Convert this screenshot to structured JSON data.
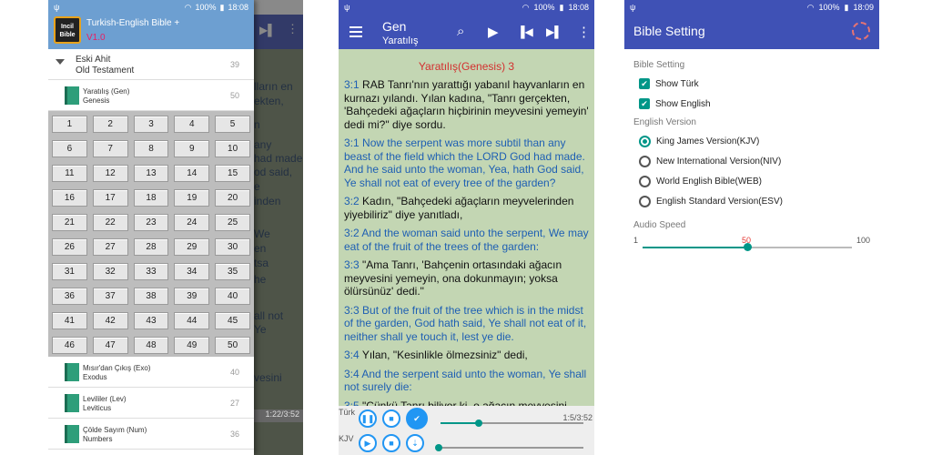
{
  "status": {
    "p1": {
      "battery": "100%",
      "time": "18:08"
    },
    "p2": {
      "battery": "100%",
      "time": "18:08"
    },
    "p3": {
      "battery": "100%",
      "time": "18:09"
    }
  },
  "drawer": {
    "app_title": "Turkish-English Bible +",
    "version": "V1.0",
    "logo_line1": "Incil",
    "logo_line2": "Bible",
    "testament": {
      "title_tr": "Eski Ahit",
      "title_en": "Old Testament",
      "count": "39"
    },
    "books": [
      {
        "tr": "Yaratılış (Gen)",
        "en": "Genesis",
        "count": "50"
      },
      {
        "tr": "Mısır'dan Çıkış (Exo)",
        "en": "Exodus",
        "count": "40"
      },
      {
        "tr": "Levililer (Lev)",
        "en": "Leviticus",
        "count": "27"
      },
      {
        "tr": "Çölde Sayım (Num)",
        "en": "Numbers",
        "count": "36"
      }
    ],
    "chapters": [
      "1",
      "2",
      "3",
      "4",
      "5",
      "6",
      "7",
      "8",
      "9",
      "10",
      "11",
      "12",
      "13",
      "14",
      "15",
      "16",
      "17",
      "18",
      "19",
      "20",
      "21",
      "22",
      "23",
      "24",
      "25",
      "26",
      "27",
      "28",
      "29",
      "30",
      "31",
      "32",
      "33",
      "34",
      "35",
      "36",
      "37",
      "38",
      "39",
      "40",
      "41",
      "42",
      "43",
      "44",
      "45",
      "46",
      "47",
      "48",
      "49",
      "50"
    ]
  },
  "behind": {
    "lines": [
      "lların en",
      "ekten,",
      "n",
      "any",
      "had made.",
      "od said,",
      "e",
      "inden",
      "We",
      "en",
      "tsa",
      "he",
      "all not",
      "Ye",
      "vesini"
    ],
    "time": "1:22/3:52"
  },
  "reader": {
    "book_short": "Gen",
    "book_tr": "Yaratılış",
    "chapter_title": "Yaratılış(Genesis) 3",
    "verses": [
      {
        "num": "3:1",
        "lang": "tr",
        "text": "RAB Tanrı'nın yarattığı yabanıl hayvanların en kurnazı yılandı. Yılan kadına, \"Tanrı gerçekten, 'Bahçedeki ağaçların hiçbirinin meyvesini yemeyin' dedi mi?\" diye sordu."
      },
      {
        "num": "3:1",
        "lang": "en",
        "text": "Now the serpent was more subtil than any beast of the field which the LORD God had made. And he said unto the woman, Yea, hath God said, Ye shall not eat of every tree of the garden?"
      },
      {
        "num": "3:2",
        "lang": "tr",
        "text": "Kadın, \"Bahçedeki ağaçların meyvelerinden yiyebiliriz\" diye yanıtladı,"
      },
      {
        "num": "3:2",
        "lang": "en",
        "text": "And the woman said unto the serpent, We may eat of the fruit of the trees of the garden:"
      },
      {
        "num": "3:3",
        "lang": "tr",
        "text": "\"Ama Tanrı, 'Bahçenin ortasındaki ağacın meyvesini yemeyin, ona dokunmayın; yoksa ölürsünüz' dedi.\""
      },
      {
        "num": "3:3",
        "lang": "en",
        "text": "But of the fruit of the tree which is in the midst of the garden, God hath said, Ye shall not eat of it, neither shall ye touch it, lest ye die."
      },
      {
        "num": "3:4",
        "lang": "tr",
        "text": "Yılan, \"Kesinlikle ölmezsiniz\" dedi,"
      },
      {
        "num": "3:4",
        "lang": "en",
        "text": "And the serpent said unto the woman, Ye shall not surely die:"
      },
      {
        "num": "3:5",
        "lang": "tr",
        "text": "\"Çünkü Tanrı biliyor ki, o ağacın meyvesini"
      }
    ],
    "player": {
      "row1_label": "Türk",
      "row2_label": "KJV",
      "time": "1:5/3:52",
      "progress1": 0.27,
      "progress2": 0.0
    }
  },
  "settings": {
    "title": "Bible Setting",
    "group1": "Bible Setting",
    "show_turk": "Show Türk",
    "show_english": "Show English",
    "group2": "English Version",
    "versions": [
      {
        "label": "King James Version(KJV)",
        "selected": true
      },
      {
        "label": "New International Version(NIV)",
        "selected": false
      },
      {
        "label": "World English Bible(WEB)",
        "selected": false
      },
      {
        "label": "English Standard Version(ESV)",
        "selected": false
      }
    ],
    "audio_label": "Audio Speed",
    "speed_min": "1",
    "speed_max": "100",
    "speed_value": "50",
    "speed_fraction": 0.5
  },
  "colors": {
    "primary": "#3f51b5",
    "accent": "#009688",
    "drawer_header": "#6d9fd1",
    "reader_bg": "#c3d6b3",
    "verse_blue": "#1e5fb3",
    "title_red": "#d32f2f"
  }
}
